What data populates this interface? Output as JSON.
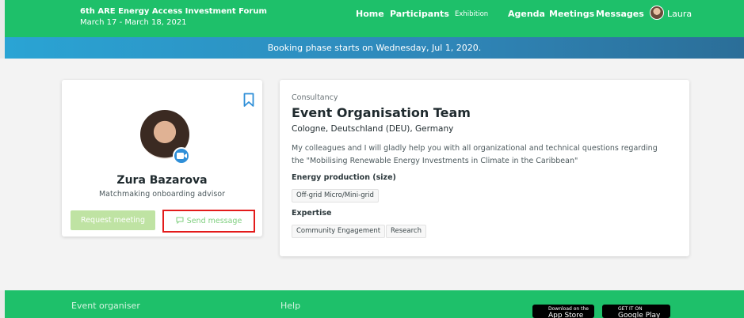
{
  "header": {
    "event_title": "6th ARE Energy Access Investment Forum",
    "event_dates": "March 17 - March 18, 2021",
    "nav": {
      "home": "Home",
      "participants": "Participants",
      "exhibition": "Exhibition",
      "agenda": "Agenda",
      "meetings": "Meetings",
      "messages": "Messages"
    },
    "user_name": "Laura"
  },
  "banner": {
    "text": "Booking phase starts on Wednesday, Jul 1, 2020."
  },
  "profile": {
    "name": "Zura Bazarova",
    "role": "Matchmaking onboarding advisor",
    "request_label": "Request meeting",
    "send_label": "Send message"
  },
  "organisation": {
    "category": "Consultancy",
    "name": "Event Organisation Team",
    "location": "Cologne, Deutschland (DEU), Germany",
    "description": "My colleagues and I will gladly help you with all organizational and technical questions regarding the \"Mobilising Renewable Energy Investments in Climate in the Caribbean\"",
    "sections": [
      {
        "label": "Energy production (size)",
        "tags": [
          "Off-grid Micro/Mini-grid"
        ]
      },
      {
        "label": "Expertise",
        "tags": [
          "Community Engagement",
          "Research"
        ]
      }
    ]
  },
  "footer": {
    "col1": "Event organiser",
    "col2": "Help",
    "app_store_small": "Download on the",
    "app_store": "App Store",
    "google_small": "GET IT ON",
    "google": "Google Play"
  },
  "colors": {
    "brand_green": "#1ec06a",
    "banner_blue": "#2f86b8",
    "highlight_red": "#e31b1b"
  }
}
